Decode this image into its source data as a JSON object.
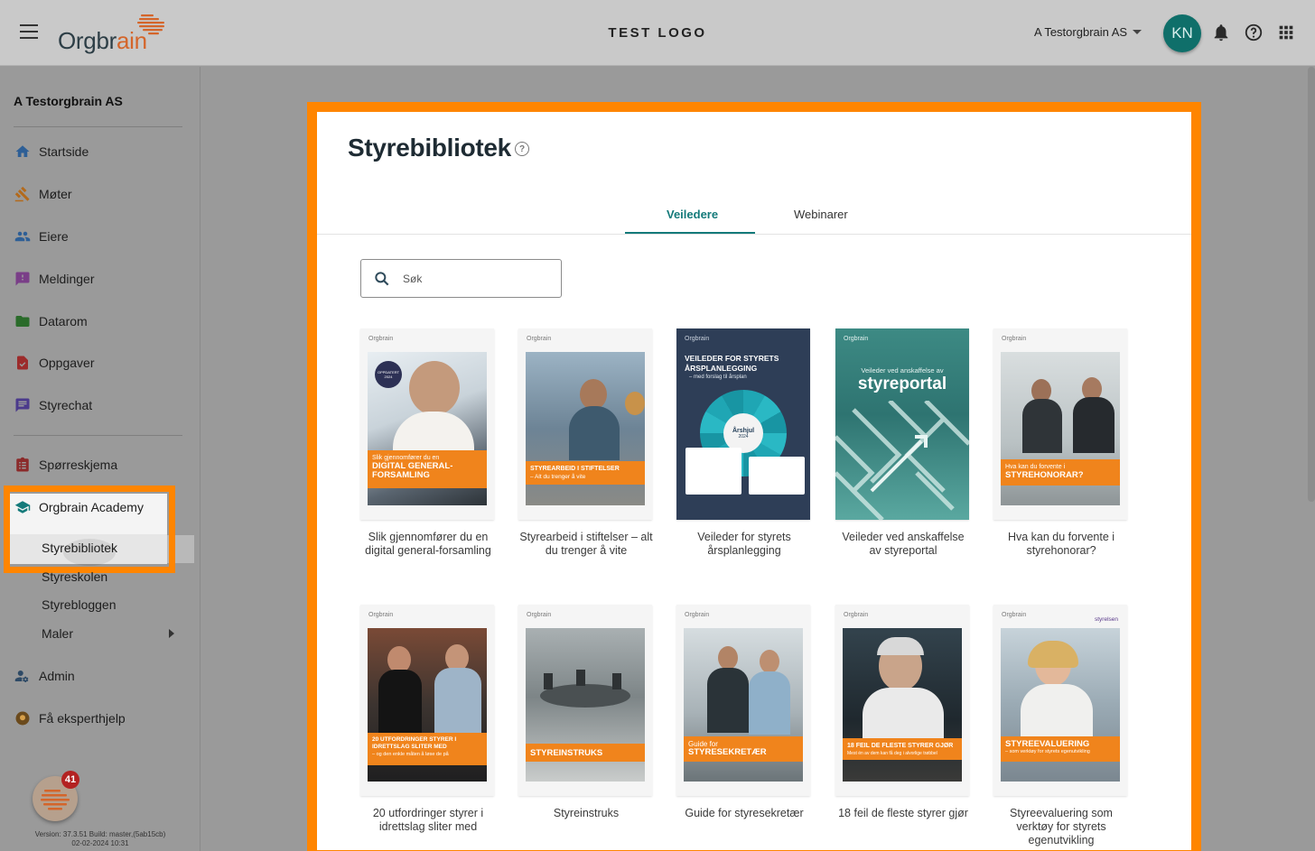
{
  "header": {
    "logo_text_main": "Orgbr",
    "logo_text_accent": "ain",
    "center_logo": "TEST LOGO",
    "company": "A Testorgbrain AS",
    "avatar_initials": "KN",
    "icons": [
      "menu-icon",
      "bell-icon",
      "help-icon",
      "apps-grid-icon"
    ]
  },
  "sidebar": {
    "org_name": "A Testorgbrain AS",
    "items": [
      {
        "label": "Startside",
        "icon": "home-icon"
      },
      {
        "label": "Møter",
        "icon": "gavel-icon"
      },
      {
        "label": "Eiere",
        "icon": "people-icon"
      },
      {
        "label": "Meldinger",
        "icon": "message-alert-icon"
      },
      {
        "label": "Datarom",
        "icon": "folder-icon"
      },
      {
        "label": "Oppgaver",
        "icon": "task-icon"
      },
      {
        "label": "Styrechat",
        "icon": "chat-icon"
      }
    ],
    "survey": {
      "label": "Spørreskjema",
      "icon": "clipboard-icon"
    },
    "academy": {
      "label": "Orgbrain Academy",
      "icon": "graduation-cap-icon",
      "subitems": [
        "Styrebibliotek",
        "Styreskolen",
        "Styrebloggen",
        "Maler"
      ]
    },
    "admin": {
      "label": "Admin",
      "icon": "admin-icon"
    },
    "expert": {
      "label": "Få eksperthjelp",
      "icon": "expert-icon"
    },
    "fab_badge": "41",
    "version_line1": "Version: 37.3.51 Build: master,(5ab15cb)",
    "version_line2": "02-02-2024 10:31"
  },
  "main": {
    "title": "Styrebibliotek",
    "help_glyph": "?",
    "tabs": [
      {
        "label": "Veiledere",
        "active": true
      },
      {
        "label": "Webinarer",
        "active": false
      }
    ],
    "search": {
      "placeholder": "Søk"
    },
    "books": [
      {
        "title": "Slik gjennomfører du en digital general-forsamling",
        "band_small": "Slik gjennomfører du en",
        "band_big": "DIGITAL GENERAL-FORSAMLING",
        "badge": "OPPDATERT 2024"
      },
      {
        "title": "Styrearbeid i stiftelser – alt du trenger å vite",
        "band_big": "STYREARBEID I STIFTELSER",
        "band_small": "– Alt du trenger å vite"
      },
      {
        "title": "Veileder for styrets årsplanlegging",
        "cover_heading": "VEILEDER FOR STYRETS ÅRSPLANLEGGING",
        "cover_sub": "– med forslag til årsplan",
        "wheel_label": "Årshjul",
        "wheel_year": "2024"
      },
      {
        "title": "Veileder ved anskaffelse av styreportal",
        "cover_small": "Veileder ved anskaffelse av",
        "cover_big": "styreportal"
      },
      {
        "title": "Hva kan du forvente i styrehonorar?",
        "band_small": "Hva kan du forvente i",
        "band_big": "STYREHONORAR?"
      },
      {
        "title": "20 utfordringer styrer i idrettslag sliter med",
        "band_big": "20 UTFORDRINGER STYRER I IDRETTSLAG SLITER MED",
        "band_small": "– og den enkle måten å løse de på"
      },
      {
        "title": "Styreinstruks",
        "band_big": "STYREINSTRUKS"
      },
      {
        "title": "Guide for styresekretær",
        "band_small": "Guide for",
        "band_big": "STYRESEKRETÆR"
      },
      {
        "title": "18 feil de fleste styrer gjør",
        "band_big": "18 FEIL DE FLESTE STYRER GJØR",
        "band_small": "Mest én av dem kan få deg i alvorlige trøbbel"
      },
      {
        "title": "Styreevaluering som verktøy for styrets egenutvikling",
        "band_big": "STYREEVALUERING",
        "band_small": "– som verktøy for styrets egenutvikling",
        "partner": "styrelsen"
      }
    ],
    "brand_tag": "Orgbrain"
  },
  "colors": {
    "accent_orange": "#ff8500",
    "teal": "#147a7a",
    "avatar": "#0f6f6a",
    "cover_orange": "#f0841c"
  }
}
